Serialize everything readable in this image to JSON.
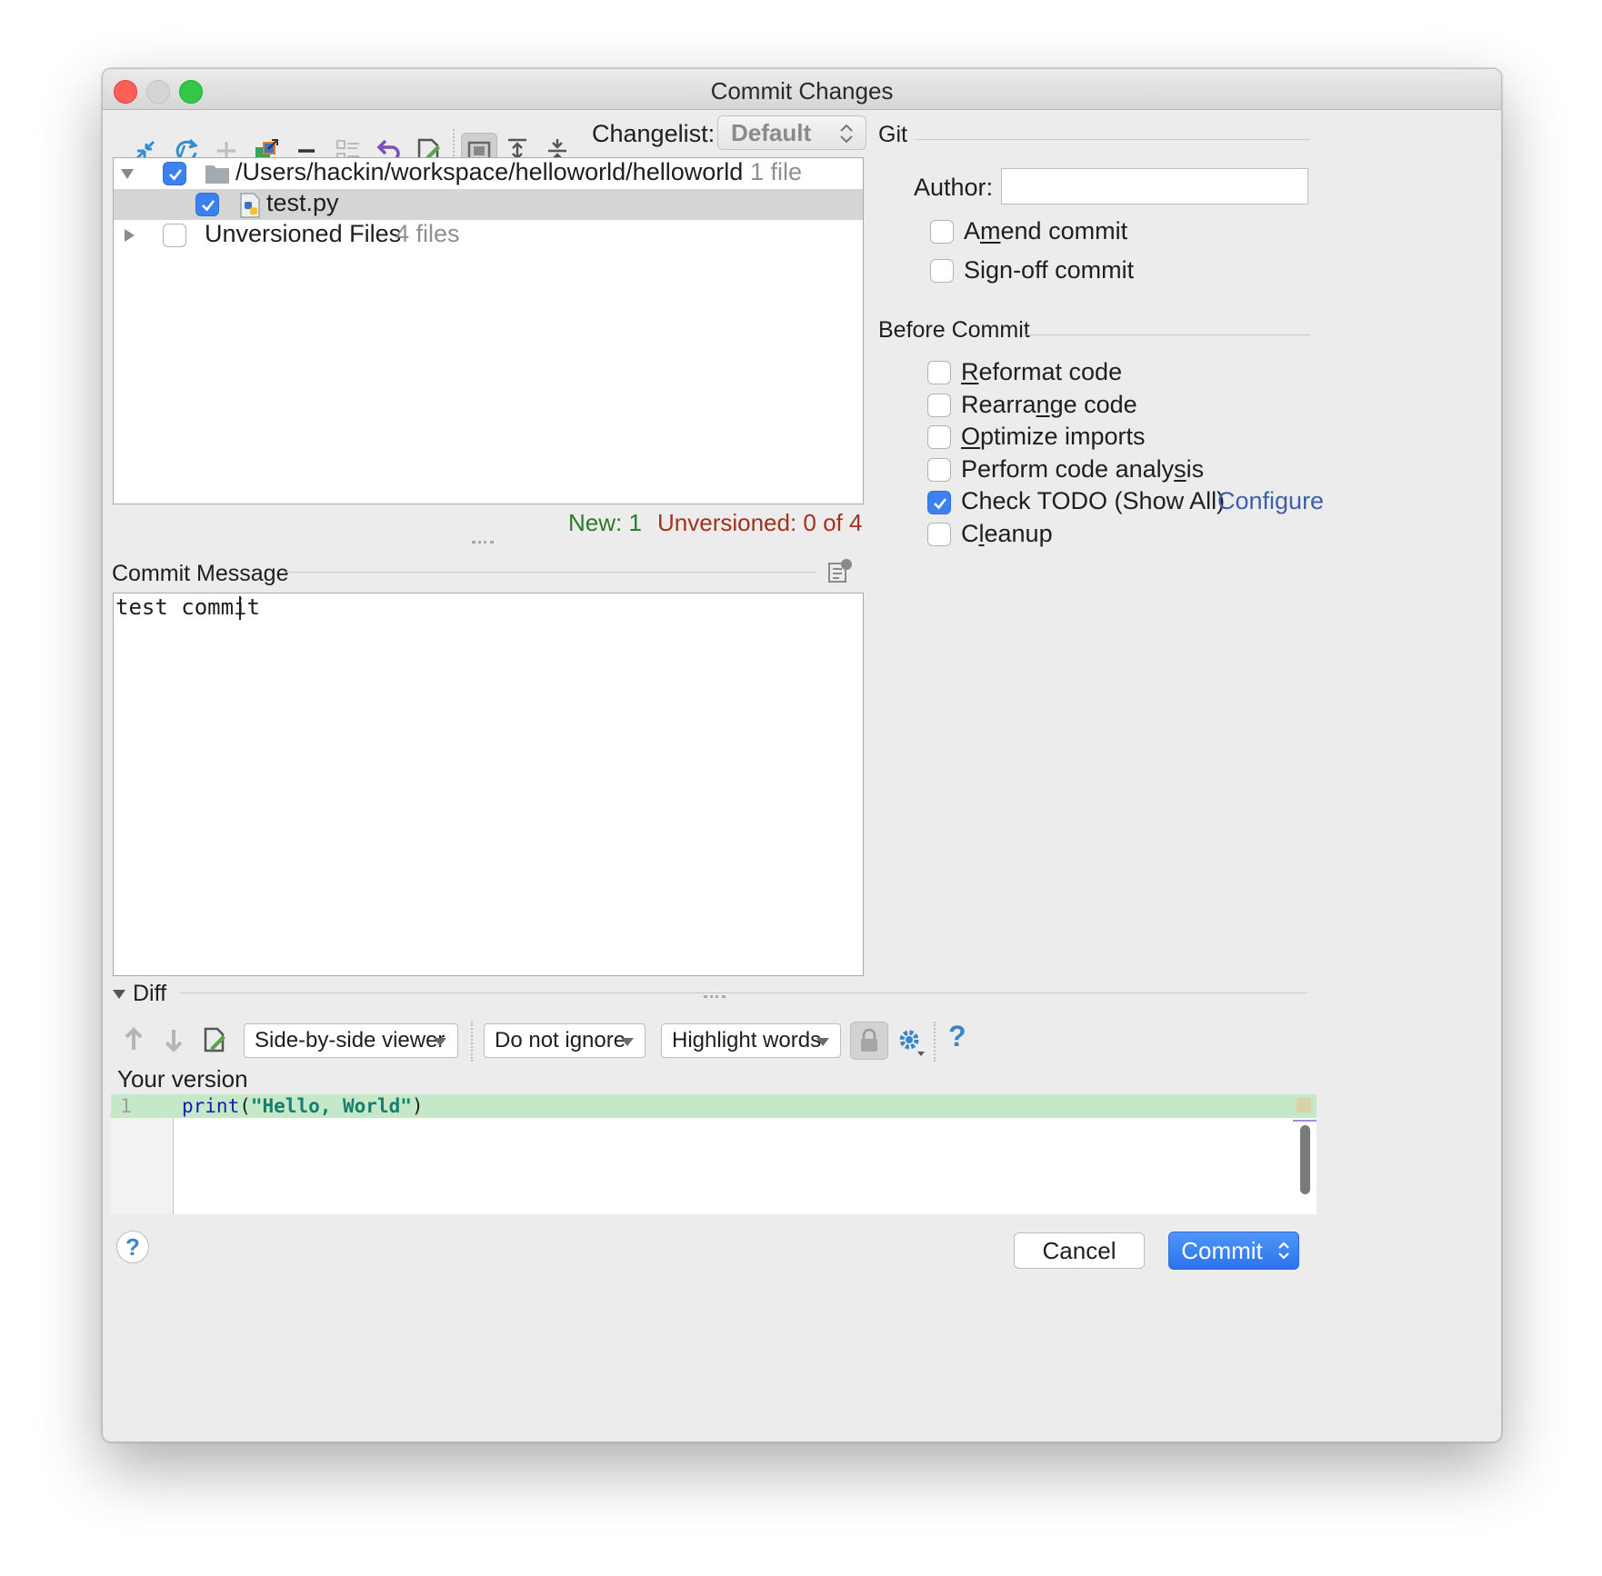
{
  "window": {
    "title": "Commit Changes"
  },
  "toolbar": {
    "changelist_label": "Changelist:",
    "changelist_value": "Default"
  },
  "tree": {
    "root_path": "/Users/hackin/workspace/helloworld/helloworld",
    "root_count": "1 file",
    "file_name": "test.py",
    "unversioned_label": "Unversioned Files",
    "unversioned_count": "4 files"
  },
  "status": {
    "new": "New: 1",
    "unversioned": "Unversioned: 0 of 4"
  },
  "commit_message": {
    "label": "Commit Message",
    "text": "test commit"
  },
  "git": {
    "section": "Git",
    "author_label": "Author:",
    "author_value": "",
    "amend_pre": "A",
    "amend_ul": "m",
    "amend_post": "end commit",
    "signoff_pre": "Si",
    "signoff_ul": "g",
    "signoff_post": "n-off commit"
  },
  "before_commit": {
    "section": "Before Commit",
    "reformat_ul": "R",
    "reformat_post": "eformat code",
    "rearrange_pre": "Rearra",
    "rearrange_ul": "n",
    "rearrange_post": "ge code",
    "optimize_ul": "O",
    "optimize_post": "ptimize imports",
    "analysis_pre": "Perform code analy",
    "analysis_ul": "s",
    "analysis_post": "is",
    "todo": "Check TODO (Show All)",
    "configure": "Configure",
    "cleanup_pre": "C",
    "cleanup_ul": "l",
    "cleanup_post": "eanup"
  },
  "diff": {
    "section": "Diff",
    "viewer": "Side-by-side viewer",
    "ignore": "Do not ignore",
    "highlight": "Highlight words",
    "help": "?",
    "your_version": "Your version",
    "line_number": "1",
    "code_fn": "print",
    "code_open": "(",
    "code_str": "\"Hello, World\"",
    "code_close": ")"
  },
  "footer": {
    "help": "?",
    "cancel": "Cancel",
    "commit": "Commit"
  },
  "colors": {
    "accent": "#3b82f0",
    "new_status": "#2c7a2c",
    "unversioned_status": "#a0321e",
    "link": "#3f5fa8",
    "diff_added": "#c4e8c8"
  }
}
